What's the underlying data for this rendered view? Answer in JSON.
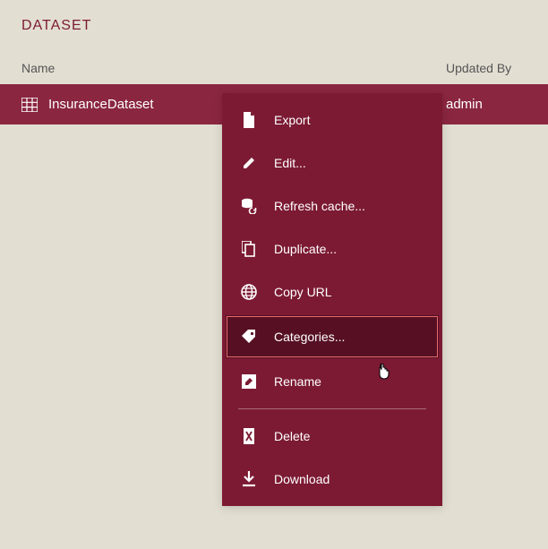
{
  "header": {
    "title": "DATASET"
  },
  "columns": {
    "name": "Name",
    "updated_by": "Updated By"
  },
  "row": {
    "name": "InsuranceDataset",
    "updated_by": "admin"
  },
  "menu": {
    "export": "Export",
    "edit": "Edit...",
    "refresh": "Refresh cache...",
    "duplicate": "Duplicate...",
    "copy_url": "Copy URL",
    "categories": "Categories...",
    "rename": "Rename",
    "delete": "Delete",
    "download": "Download"
  },
  "colors": {
    "accent": "#7c1a33",
    "row_bg": "#8a2640",
    "highlight_bg": "#571023",
    "highlight_border": "#e56a6a",
    "page_bg": "#e2ded2"
  }
}
